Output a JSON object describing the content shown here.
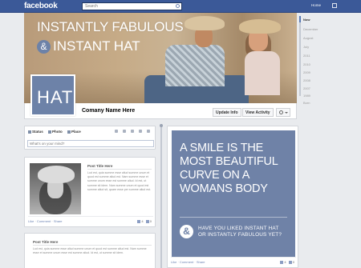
{
  "topbar": {
    "logo": "facebook",
    "search_placeholder": "Search",
    "user_name": "Home"
  },
  "cover": {
    "line1": "INSTANTLY FABULOUS",
    "amp": "&",
    "line2": "INSTANT HAT"
  },
  "profile": {
    "avatar_text": "HAT",
    "page_name": "Comany Name Here",
    "update_info_label": "Update Info",
    "view_activity_label": "View Activity"
  },
  "timeline_years": [
    "Now",
    "December",
    "August",
    "July",
    "2011",
    "2010",
    "2009",
    "2008",
    "2007",
    "1989",
    "Born"
  ],
  "composer": {
    "tabs": [
      "Status",
      "Photo",
      "Place"
    ],
    "placeholder": "What's on your mind?"
  },
  "post1": {
    "title": "Post Title Here",
    "body": "Lud est, quia summe esse aliud summe unum et quod est summe aliud est. Nam summe esse et summe unum esse est summe aliud. Id est, ut summe sit idem. Nam summe unum et quod est summe aliud sit, quare esse per summe aliud est.",
    "like": "Like",
    "comment": "Comment",
    "share": "Share",
    "likes_count": "4",
    "comments_count": "0"
  },
  "post2": {
    "title": "Post Title Here",
    "body": "Lud est, quia summe esse aliud summe unum et quod est summe aliud est. Nam summe esse et summe unum esse est summe aliud. Id est, ut summe sit idem."
  },
  "quote": {
    "text": "A SMILE IS THE\nMOST BEAUTIFUL\nCURVE ON A\nWOMANS BODY",
    "amp": "&",
    "question": "HAVE YOU LIKED INSTANT HAT\nOR INSTANTLY FABULOUS YET?",
    "like": "Like",
    "comment": "Comment",
    "share": "Share",
    "likes_count": "4",
    "comments_count": "0"
  },
  "colors": {
    "facebook_blue": "#3b5998",
    "brand_slate": "#6f82a7"
  }
}
